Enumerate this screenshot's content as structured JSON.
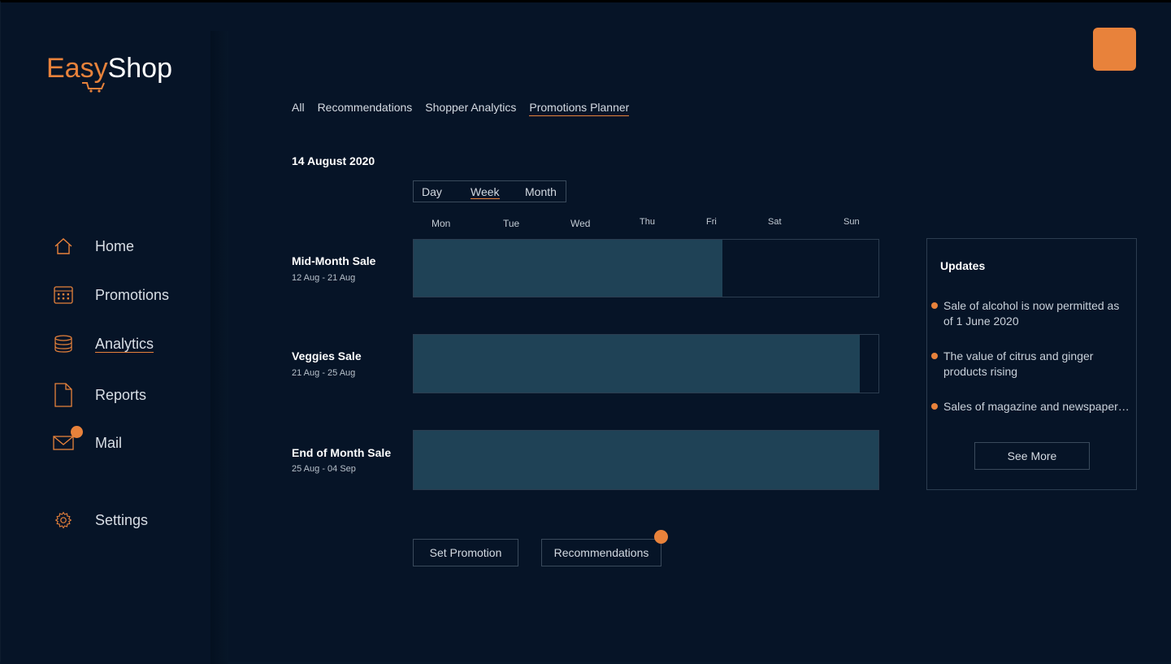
{
  "brand": {
    "part1": "Easy",
    "part2": "Shop"
  },
  "sidebar": {
    "items": [
      {
        "label": "Home",
        "icon": "home-icon"
      },
      {
        "label": "Promotions",
        "icon": "calendar-icon"
      },
      {
        "label": "Analytics",
        "icon": "database-icon",
        "active": true
      },
      {
        "label": "Reports",
        "icon": "document-icon"
      },
      {
        "label": "Mail",
        "icon": "mail-icon",
        "badge": true
      },
      {
        "label": "Settings",
        "icon": "gear-icon"
      }
    ]
  },
  "tabs": [
    {
      "label": "All"
    },
    {
      "label": "Recommendations"
    },
    {
      "label": "Shopper Analytics"
    },
    {
      "label": "Promotions Planner",
      "active": true
    }
  ],
  "date_title": "14 August 2020",
  "view_toggle": {
    "day": "Day",
    "week": "Week",
    "month": "Month",
    "selected": "Week"
  },
  "days": [
    "Mon",
    "Tue",
    "Wed",
    "Thu",
    "Fri",
    "Sat",
    "Sun"
  ],
  "promotions": [
    {
      "name": "Mid-Month Sale",
      "range": "12 Aug - 21 Aug",
      "fill": 0.664
    },
    {
      "name": "Veggies Sale",
      "range": "21 Aug - 25 Aug",
      "fill": 0.96
    },
    {
      "name": "End of Month Sale",
      "range": "25 Aug - 04 Sep",
      "fill": 1.0
    }
  ],
  "buttons": {
    "set_promotion": "Set Promotion",
    "recommendations": "Recommendations"
  },
  "updates": {
    "title": "Updates",
    "items": [
      "Sale of alcohol is now permitted as of 1 June 2020",
      "The value of citrus and ginger products rising",
      "Sales of magazine and newspaper…"
    ],
    "see_more": "See More"
  },
  "colors": {
    "accent": "#e8823b",
    "background": "#061427",
    "bar_fill": "#1f4256"
  }
}
